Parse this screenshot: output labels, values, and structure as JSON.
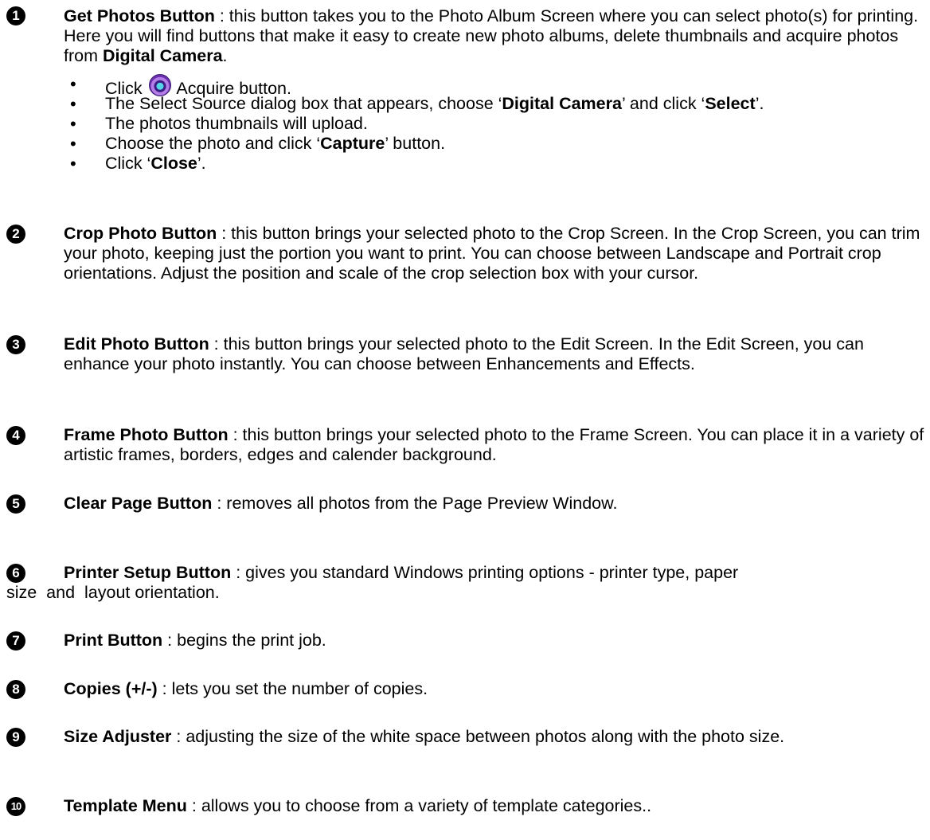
{
  "items": [
    {
      "number": "1",
      "title": "Get Photos Button",
      "text_a": " : this button takes you to the Photo Album Screen where you can select photo(s) for printing. Here you will find buttons that make it easy to create new photo albums, delete thumbnails and acquire photos from ",
      "bold_a": "Digital Camera",
      "text_b": ".",
      "bullets": {
        "b1_pre": "Click ",
        "b1_icon": "acquire-icon",
        "b1_post": " Acquire button.",
        "b2_pre": "The Select Source dialog box that appears, choose ‘",
        "b2_bold1": "Digital Camera",
        "b2_mid": "’ and click ‘",
        "b2_bold2": "Select",
        "b2_post": "’.",
        "b3": "The photos thumbnails will upload.",
        "b4_pre": "Choose the photo and click ‘",
        "b4_bold": "Capture",
        "b4_post": "’ button.",
        "b5_pre": "Click ‘",
        "b5_bold": "Close",
        "b5_post": "’."
      }
    },
    {
      "number": "2",
      "title": "Crop Photo Button",
      "text": " : this button brings your selected photo to the Crop Screen. In the Crop Screen, you can trim your photo, keeping just the portion you want to print. You can choose between Landscape and Portrait crop orientations. Adjust the position and scale of the crop selection box with your cursor."
    },
    {
      "number": "3",
      "title": "Edit Photo Button",
      "text": " : this button brings your selected photo to the Edit Screen. In the Edit Screen, you can enhance your photo instantly. You can choose between Enhancements and Effects."
    },
    {
      "number": "4",
      "title": "Frame Photo Button",
      "text": " : this button brings your selected photo to the Frame Screen. You can place it in a variety of artistic frames, borders, edges and calender background."
    },
    {
      "number": "5",
      "title": "Clear Page Button",
      "text": " : removes all photos from the Page Preview Window."
    },
    {
      "number": "6",
      "title": "Printer Setup Button",
      "text_a": " : gives you standard Windows printing options - printer type, paper",
      "text_b": "size  and  layout orientation."
    },
    {
      "number": "7",
      "title": "Print Button",
      "text": " : begins the print job."
    },
    {
      "number": "8",
      "title": "Copies (+/-)",
      "text": " : lets you set the number of copies."
    },
    {
      "number": "9",
      "title": "Size Adjuster",
      "text": " : adjusting the size of the white space between photos along with the photo size."
    },
    {
      "number": "10",
      "title": "Template Menu",
      "text": " : allows you to choose from a variety of template categories.."
    }
  ]
}
